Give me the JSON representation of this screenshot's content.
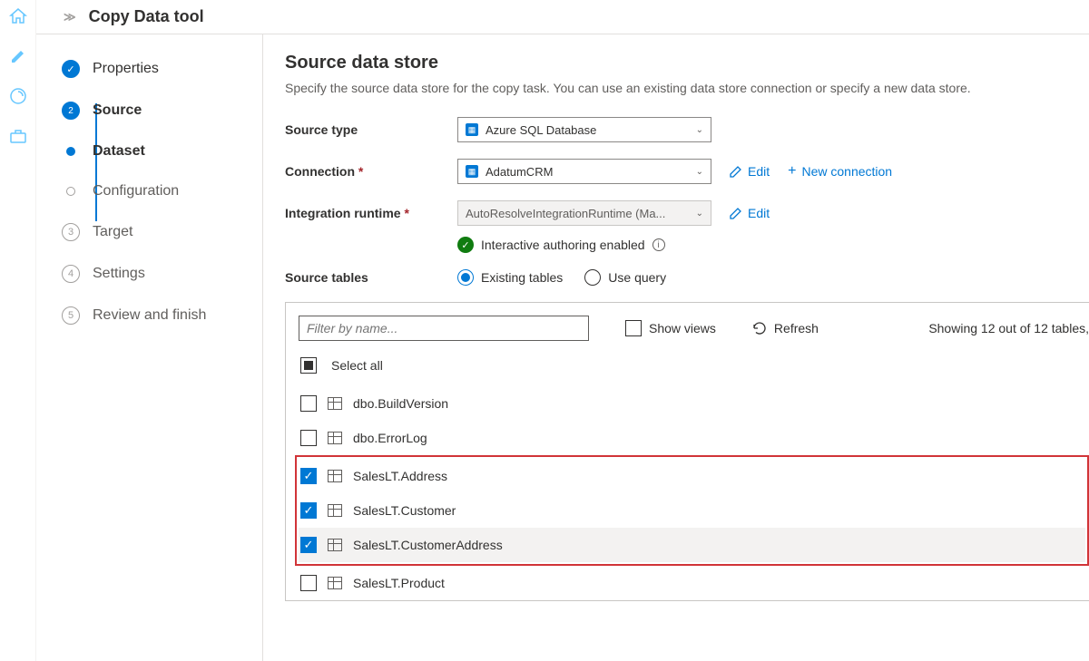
{
  "header": {
    "title": "Copy Data tool"
  },
  "steps": [
    {
      "label": "Properties",
      "state": "done"
    },
    {
      "label": "Source",
      "state": "current",
      "num": "2"
    },
    {
      "label": "Dataset",
      "state": "sub-current"
    },
    {
      "label": "Configuration",
      "state": "sub-pending"
    },
    {
      "label": "Target",
      "state": "pending",
      "num": "3"
    },
    {
      "label": "Settings",
      "state": "pending",
      "num": "4"
    },
    {
      "label": "Review and finish",
      "state": "pending",
      "num": "5"
    }
  ],
  "main": {
    "heading": "Source data store",
    "subtitle": "Specify the source data store for the copy task. You can use an existing data store connection or specify a new data store.",
    "source_type_label": "Source type",
    "source_type_value": "Azure SQL Database",
    "connection_label": "Connection",
    "connection_value": "AdatumCRM",
    "edit_label": "Edit",
    "new_connection_label": "New connection",
    "runtime_label": "Integration runtime",
    "runtime_value": "AutoResolveIntegrationRuntime (Ma...",
    "status_text": "Interactive authoring enabled",
    "source_tables_label": "Source tables",
    "radio_existing": "Existing tables",
    "radio_query": "Use query"
  },
  "tables": {
    "filter_placeholder": "Filter by name...",
    "show_views_label": "Show views",
    "refresh_label": "Refresh",
    "showing_text": "Showing 12 out of 12 tables,",
    "select_all_label": "Select all",
    "rows": [
      {
        "name": "dbo.BuildVersion",
        "checked": false
      },
      {
        "name": "dbo.ErrorLog",
        "checked": false
      },
      {
        "name": "SalesLT.Address",
        "checked": true
      },
      {
        "name": "SalesLT.Customer",
        "checked": true
      },
      {
        "name": "SalesLT.CustomerAddress",
        "checked": true,
        "hover": true
      },
      {
        "name": "SalesLT.Product",
        "checked": false
      }
    ]
  }
}
